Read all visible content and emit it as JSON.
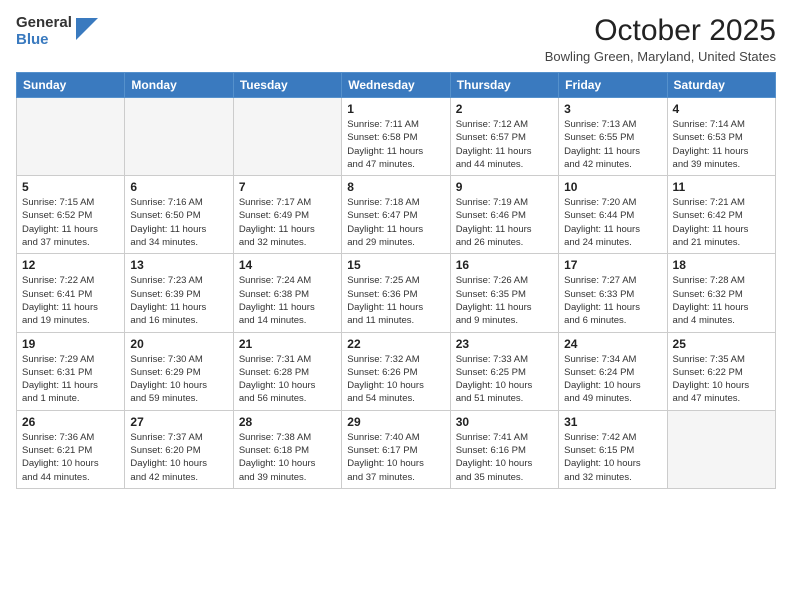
{
  "logo": {
    "line1": "General",
    "line2": "Blue"
  },
  "title": "October 2025",
  "subtitle": "Bowling Green, Maryland, United States",
  "weekdays": [
    "Sunday",
    "Monday",
    "Tuesday",
    "Wednesday",
    "Thursday",
    "Friday",
    "Saturday"
  ],
  "weeks": [
    [
      {
        "day": "",
        "info": ""
      },
      {
        "day": "",
        "info": ""
      },
      {
        "day": "",
        "info": ""
      },
      {
        "day": "1",
        "info": "Sunrise: 7:11 AM\nSunset: 6:58 PM\nDaylight: 11 hours\nand 47 minutes."
      },
      {
        "day": "2",
        "info": "Sunrise: 7:12 AM\nSunset: 6:57 PM\nDaylight: 11 hours\nand 44 minutes."
      },
      {
        "day": "3",
        "info": "Sunrise: 7:13 AM\nSunset: 6:55 PM\nDaylight: 11 hours\nand 42 minutes."
      },
      {
        "day": "4",
        "info": "Sunrise: 7:14 AM\nSunset: 6:53 PM\nDaylight: 11 hours\nand 39 minutes."
      }
    ],
    [
      {
        "day": "5",
        "info": "Sunrise: 7:15 AM\nSunset: 6:52 PM\nDaylight: 11 hours\nand 37 minutes."
      },
      {
        "day": "6",
        "info": "Sunrise: 7:16 AM\nSunset: 6:50 PM\nDaylight: 11 hours\nand 34 minutes."
      },
      {
        "day": "7",
        "info": "Sunrise: 7:17 AM\nSunset: 6:49 PM\nDaylight: 11 hours\nand 32 minutes."
      },
      {
        "day": "8",
        "info": "Sunrise: 7:18 AM\nSunset: 6:47 PM\nDaylight: 11 hours\nand 29 minutes."
      },
      {
        "day": "9",
        "info": "Sunrise: 7:19 AM\nSunset: 6:46 PM\nDaylight: 11 hours\nand 26 minutes."
      },
      {
        "day": "10",
        "info": "Sunrise: 7:20 AM\nSunset: 6:44 PM\nDaylight: 11 hours\nand 24 minutes."
      },
      {
        "day": "11",
        "info": "Sunrise: 7:21 AM\nSunset: 6:42 PM\nDaylight: 11 hours\nand 21 minutes."
      }
    ],
    [
      {
        "day": "12",
        "info": "Sunrise: 7:22 AM\nSunset: 6:41 PM\nDaylight: 11 hours\nand 19 minutes."
      },
      {
        "day": "13",
        "info": "Sunrise: 7:23 AM\nSunset: 6:39 PM\nDaylight: 11 hours\nand 16 minutes."
      },
      {
        "day": "14",
        "info": "Sunrise: 7:24 AM\nSunset: 6:38 PM\nDaylight: 11 hours\nand 14 minutes."
      },
      {
        "day": "15",
        "info": "Sunrise: 7:25 AM\nSunset: 6:36 PM\nDaylight: 11 hours\nand 11 minutes."
      },
      {
        "day": "16",
        "info": "Sunrise: 7:26 AM\nSunset: 6:35 PM\nDaylight: 11 hours\nand 9 minutes."
      },
      {
        "day": "17",
        "info": "Sunrise: 7:27 AM\nSunset: 6:33 PM\nDaylight: 11 hours\nand 6 minutes."
      },
      {
        "day": "18",
        "info": "Sunrise: 7:28 AM\nSunset: 6:32 PM\nDaylight: 11 hours\nand 4 minutes."
      }
    ],
    [
      {
        "day": "19",
        "info": "Sunrise: 7:29 AM\nSunset: 6:31 PM\nDaylight: 11 hours\nand 1 minute."
      },
      {
        "day": "20",
        "info": "Sunrise: 7:30 AM\nSunset: 6:29 PM\nDaylight: 10 hours\nand 59 minutes."
      },
      {
        "day": "21",
        "info": "Sunrise: 7:31 AM\nSunset: 6:28 PM\nDaylight: 10 hours\nand 56 minutes."
      },
      {
        "day": "22",
        "info": "Sunrise: 7:32 AM\nSunset: 6:26 PM\nDaylight: 10 hours\nand 54 minutes."
      },
      {
        "day": "23",
        "info": "Sunrise: 7:33 AM\nSunset: 6:25 PM\nDaylight: 10 hours\nand 51 minutes."
      },
      {
        "day": "24",
        "info": "Sunrise: 7:34 AM\nSunset: 6:24 PM\nDaylight: 10 hours\nand 49 minutes."
      },
      {
        "day": "25",
        "info": "Sunrise: 7:35 AM\nSunset: 6:22 PM\nDaylight: 10 hours\nand 47 minutes."
      }
    ],
    [
      {
        "day": "26",
        "info": "Sunrise: 7:36 AM\nSunset: 6:21 PM\nDaylight: 10 hours\nand 44 minutes."
      },
      {
        "day": "27",
        "info": "Sunrise: 7:37 AM\nSunset: 6:20 PM\nDaylight: 10 hours\nand 42 minutes."
      },
      {
        "day": "28",
        "info": "Sunrise: 7:38 AM\nSunset: 6:18 PM\nDaylight: 10 hours\nand 39 minutes."
      },
      {
        "day": "29",
        "info": "Sunrise: 7:40 AM\nSunset: 6:17 PM\nDaylight: 10 hours\nand 37 minutes."
      },
      {
        "day": "30",
        "info": "Sunrise: 7:41 AM\nSunset: 6:16 PM\nDaylight: 10 hours\nand 35 minutes."
      },
      {
        "day": "31",
        "info": "Sunrise: 7:42 AM\nSunset: 6:15 PM\nDaylight: 10 hours\nand 32 minutes."
      },
      {
        "day": "",
        "info": ""
      }
    ]
  ]
}
